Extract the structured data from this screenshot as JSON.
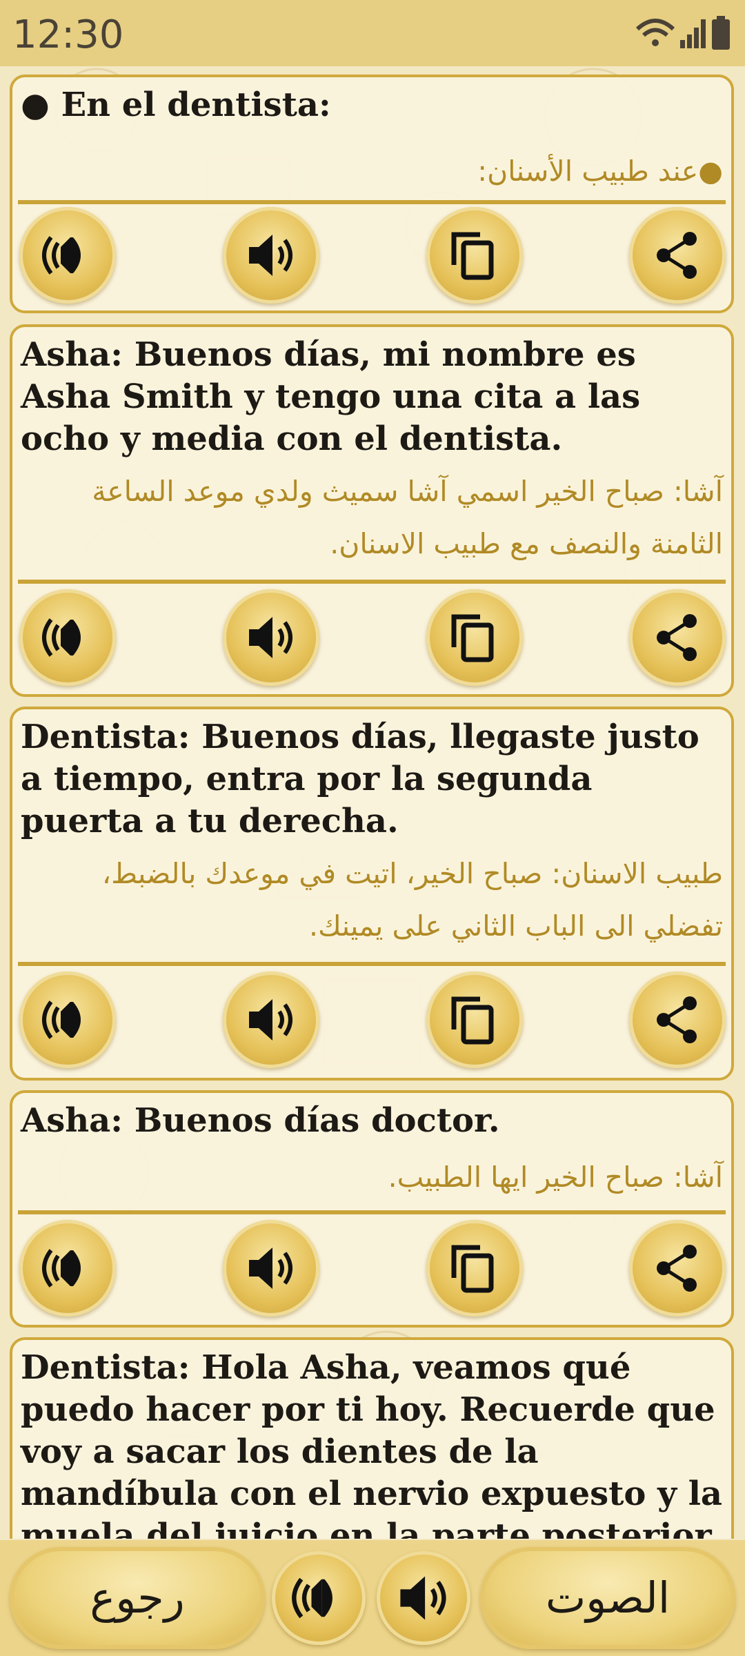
{
  "status": {
    "time": "12:30"
  },
  "cards": [
    {
      "es": "● En el dentista:",
      "ar": "●عند طبيب الأسنان:"
    },
    {
      "es": "Asha: Buenos días, mi nombre es Asha Smith y tengo una cita a las ocho y media con el dentista.",
      "ar": "آشا: صباح الخير اسمي آشا سميث ولدي موعد الساعة الثامنة والنصف مع طبيب الاسنان."
    },
    {
      "es": "Dentista: Buenos días, llegaste justo a tiempo, entra por la segunda puerta a tu derecha.",
      "ar": "طبيب الاسنان: صباح الخير، اتيت في موعدك بالضبط، تفضلي الى الباب الثاني على يمينك."
    },
    {
      "es": "Asha: Buenos días doctor.",
      "ar": "آشا: صباح الخير ايها الطبيب."
    },
    {
      "es": "Dentista: Hola Asha, veamos qué puedo hacer por ti hoy. Recuerde que voy a sacar los dientes de la mandíbula con el nervio expuesto y la muela del juicio en la parte posterior"
    }
  ],
  "card_buttons": [
    "slow-speaker-icon",
    "speaker-icon",
    "copy-icon",
    "share-icon"
  ],
  "bottom": {
    "back_label": "رجوع",
    "sound_label": "الصوت"
  },
  "colors": {
    "accent": "#cfa93c",
    "arabic_text": "#b08a25",
    "background": "#f3e8c4"
  }
}
